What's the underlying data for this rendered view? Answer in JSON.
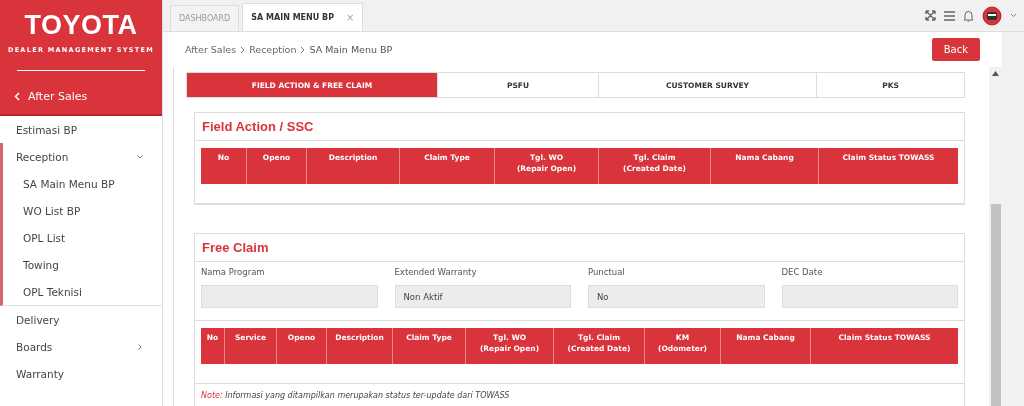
{
  "brand": {
    "logo": "TOYOTA",
    "subtitle": "DEALER MANAGEMENT SYSTEM"
  },
  "sidebar": {
    "back_label": "After Sales",
    "items": [
      {
        "label": "Estimasi BP"
      },
      {
        "label": "Reception",
        "expanded": true,
        "children": [
          {
            "label": "SA Main Menu BP"
          },
          {
            "label": "WO List BP"
          },
          {
            "label": "OPL List"
          },
          {
            "label": "Towing"
          },
          {
            "label": "OPL Teknisi"
          }
        ]
      },
      {
        "label": "Delivery"
      },
      {
        "label": "Boards",
        "expanded": false
      },
      {
        "label": "Warranty"
      }
    ]
  },
  "top_tabs": [
    {
      "label": "DASHBOARD",
      "selected": false
    },
    {
      "label": "SA MAIN MENU BP",
      "selected": true,
      "close": "×"
    }
  ],
  "breadcrumb": [
    "After Sales",
    "Reception",
    "SA Main Menu BP"
  ],
  "back_button": "Back",
  "tabs": [
    {
      "label": "FIELD ACTION & FREE CLAIM",
      "selected": true
    },
    {
      "label": "PSFU",
      "selected": false
    },
    {
      "label": "CUSTOMER SURVEY",
      "selected": false
    },
    {
      "label": "PKS",
      "selected": false
    }
  ],
  "field_action": {
    "title": "Field Action / SSC",
    "columns": [
      "No",
      "Openo",
      "Description",
      "Claim Type",
      "Tgl. WO\n(Repair Open)",
      "Tgl. Claim\n(Created Date)",
      "Nama Cabang",
      "Claim Status TOWASS"
    ]
  },
  "free_claim": {
    "title": "Free Claim",
    "fields": [
      {
        "label": "Nama Program"
      },
      {
        "label": "Extended Warranty",
        "value": "Non Aktif"
      },
      {
        "label": "Punctual",
        "value": "No"
      },
      {
        "label": "DEC Date"
      }
    ],
    "columns": [
      "No",
      "Service",
      "Openo",
      "Description",
      "Claim Type",
      "Tgl. WO\n(Repair Open)",
      "Tgl. Claim\n(Created Date)",
      "KM\n(Odometer)",
      "Nama Cabang",
      "Claim Status TOWASS"
    ],
    "note": {
      "label": "Note:",
      "text": "Informasi yang ditampilkan merupakan status ter-update dari TOWASS"
    }
  }
}
